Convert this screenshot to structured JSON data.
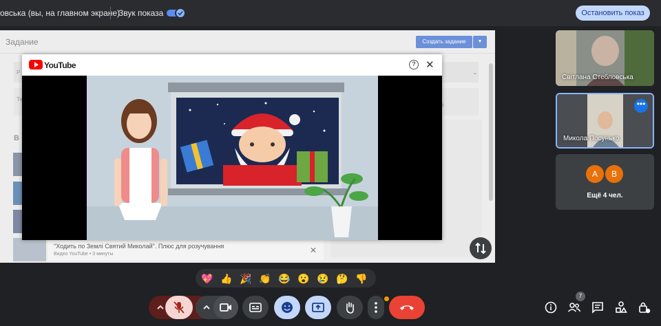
{
  "topbar": {
    "presenting_text": "овська (вы, на главном экране)",
    "sound_label": "Звук показа",
    "sound_on": true,
    "stop_button": "Остановить показ"
  },
  "shared_screen": {
    "page_title": "Задание",
    "create_button": "Создать задание",
    "section_letter": "В",
    "row_r": "Р",
    "row_te": "Те",
    "side_link": "а",
    "video_title": "\"Ходить по Землі Святий Миколай\". Плюс для розучування",
    "video_meta": "Видео YouTube • 3 минуты",
    "close_symbol": "✕"
  },
  "youtube": {
    "brand": "YouTube",
    "help_symbol": "?",
    "close_symbol": "✕"
  },
  "participants": [
    {
      "name": "Світлана Стебловська"
    },
    {
      "name": "Микола Посунько"
    }
  ],
  "more_tile": {
    "avatars": [
      "А",
      "В"
    ],
    "label": "Ещё 4 чел."
  },
  "reactions": [
    "💖",
    "👍",
    "🎉",
    "👏",
    "😂",
    "😮",
    "😢",
    "🤔",
    "👎"
  ],
  "people_count": "7",
  "colors": {
    "accent": "#8ab4f8",
    "end_call": "#ea4335",
    "mic_off_bg": "#f6d6d3",
    "active_ctrl": "#c2d7fb"
  }
}
